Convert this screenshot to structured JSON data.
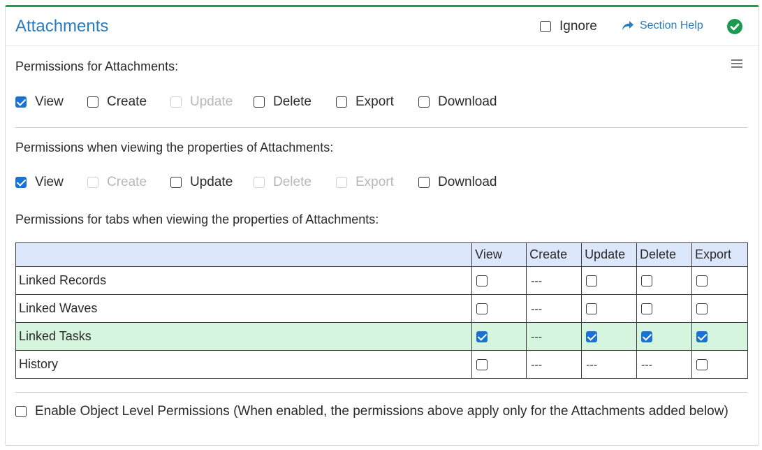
{
  "header": {
    "title": "Attachments",
    "ignore_label": "Ignore",
    "ignore_checked": false,
    "help_label": "Section Help",
    "status_color": "#1b9a52"
  },
  "section1": {
    "label": "Permissions for Attachments:",
    "options": [
      {
        "label": "View",
        "checked": true,
        "disabled": false
      },
      {
        "label": "Create",
        "checked": false,
        "disabled": false
      },
      {
        "label": "Update",
        "checked": false,
        "disabled": true
      },
      {
        "label": "Delete",
        "checked": false,
        "disabled": false
      },
      {
        "label": "Export",
        "checked": false,
        "disabled": false
      },
      {
        "label": "Download",
        "checked": false,
        "disabled": false
      }
    ]
  },
  "section2": {
    "label": "Permissions when viewing the properties of Attachments:",
    "options": [
      {
        "label": "View",
        "checked": true,
        "disabled": false
      },
      {
        "label": "Create",
        "checked": false,
        "disabled": true
      },
      {
        "label": "Update",
        "checked": false,
        "disabled": false
      },
      {
        "label": "Delete",
        "checked": false,
        "disabled": true
      },
      {
        "label": "Export",
        "checked": false,
        "disabled": true
      },
      {
        "label": "Download",
        "checked": false,
        "disabled": false
      }
    ]
  },
  "section3": {
    "label": "Permissions for tabs when viewing the properties of Attachments:",
    "columns": [
      "",
      "View",
      "Create",
      "Update",
      "Delete",
      "Export"
    ],
    "rows": [
      {
        "name": "Linked Records",
        "cells": [
          "unchecked",
          "---",
          "unchecked",
          "unchecked",
          "unchecked"
        ],
        "highlight": false
      },
      {
        "name": "Linked Waves",
        "cells": [
          "unchecked",
          "---",
          "unchecked",
          "unchecked",
          "unchecked"
        ],
        "highlight": false
      },
      {
        "name": "Linked Tasks",
        "cells": [
          "checked",
          "---",
          "checked",
          "checked",
          "checked"
        ],
        "highlight": true
      },
      {
        "name": "History",
        "cells": [
          "unchecked",
          "---",
          "---",
          "---",
          "unchecked"
        ],
        "highlight": false
      }
    ],
    "dash": "---",
    "highlight_color": "#d6f5de"
  },
  "object_level": {
    "label": "Enable Object Level Permissions (When enabled, the permissions above apply only for the Attachments added below)",
    "checked": false
  },
  "colors": {
    "accent": "#2a7bbf",
    "checkbox_checked": "#1a73d2",
    "table_header_bg": "#dde7fb"
  }
}
